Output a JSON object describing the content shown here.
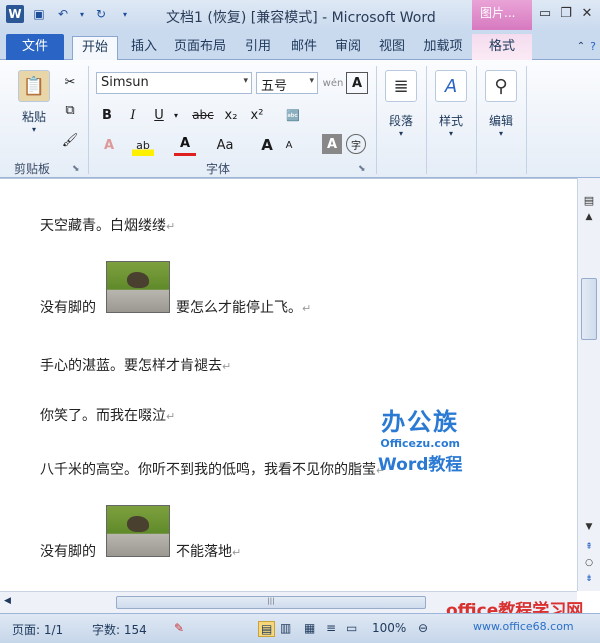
{
  "window": {
    "title": "文档1 (恢复) [兼容模式] - Microsoft Word",
    "context_tab_group": "图片..."
  },
  "tabs": [
    "文件",
    "开始",
    "插入",
    "页面布局",
    "引用",
    "邮件",
    "审阅",
    "视图",
    "加载项",
    "格式"
  ],
  "ribbon": {
    "clipboard": {
      "paste_label": "粘贴",
      "group_label": "剪贴板"
    },
    "font": {
      "font_name": "Simsun",
      "font_size": "五号",
      "group_label": "字体",
      "bold": "B",
      "italic": "I",
      "underline": "U",
      "strike": "abc",
      "sub": "x₂",
      "sup": "x²",
      "grow": "A",
      "aa": "Aa"
    },
    "paragraph": {
      "label": "段落"
    },
    "styles": {
      "label": "样式"
    },
    "editing": {
      "label": "编辑"
    }
  },
  "document": {
    "lines": [
      "天空藏青。白烟缕缕",
      "没有脚的",
      "。要怎么才能停止飞。",
      "手心的湛蓝。要怎样才肯褪去",
      "你笑了。而我在啜泣",
      "八千米的高空。你听不到我的低鸣，我看不见你的脂莹",
      "没有脚的",
      "。不能落地"
    ],
    "watermark": {
      "brand": "办公族",
      "domain": "Officezu.com",
      "word": "Word教程"
    }
  },
  "status": {
    "page": "页面: 1/1",
    "words": "字数: 154",
    "zoom": "100%"
  },
  "footer_watermark": {
    "site": "office教程学习网",
    "url": "www.office68.com"
  }
}
